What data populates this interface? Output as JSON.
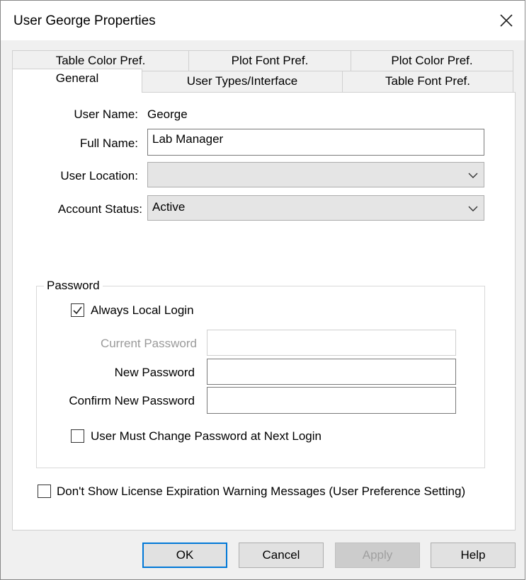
{
  "window": {
    "title": "User George Properties"
  },
  "tabs": {
    "row1": [
      "Table Color Pref.",
      "Plot Font Pref.",
      "Plot Color Pref."
    ],
    "row2": [
      "General",
      "User Types/Interface",
      "Table Font Pref."
    ]
  },
  "general": {
    "user_name_label": "User Name:",
    "user_name_value": "George",
    "full_name_label": "Full Name:",
    "full_name_value": "Lab Manager",
    "user_location_label": "User Location:",
    "user_location_value": "",
    "account_status_label": "Account Status:",
    "account_status_value": "Active"
  },
  "password": {
    "group_title": "Password",
    "always_local_login_label": "Always Local Login",
    "always_local_login_checked": true,
    "current_password_label": "Current Password",
    "new_password_label": "New Password",
    "confirm_password_label": "Confirm New Password",
    "must_change_label": "User Must Change Password at Next Login",
    "must_change_checked": false
  },
  "license_warning": {
    "label": "Don't Show License Expiration Warning Messages (User Preference Setting)",
    "checked": false
  },
  "buttons": {
    "ok": "OK",
    "cancel": "Cancel",
    "apply": "Apply",
    "help": "Help"
  }
}
